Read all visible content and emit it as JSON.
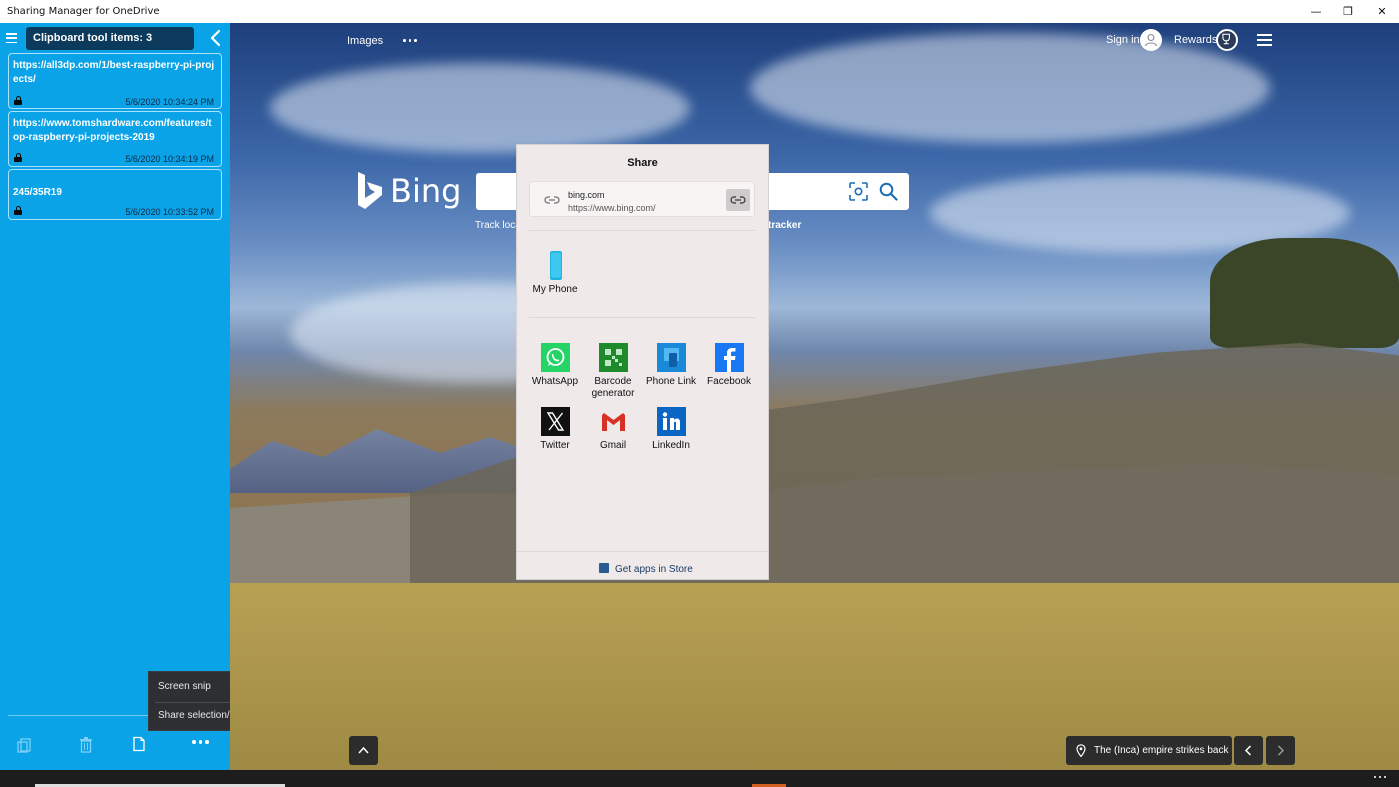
{
  "window": {
    "title": "Sharing Manager for OneDrive",
    "controls": {
      "minimize": "—",
      "restore": "❐",
      "close": "✕"
    }
  },
  "sidebar": {
    "count_label": "Clipboard tool items: 3",
    "items": [
      {
        "text": "https://all3dp.com/1/best-raspberry-pi-projects/",
        "timestamp": "5/6/2020 10:34:24 PM"
      },
      {
        "text": "https://www.tomshardware.com/features/top-raspberry-pi-projects-2019",
        "timestamp": "5/6/2020 10:34:19 PM"
      },
      {
        "text": "245/35R19",
        "timestamp": "5/6/2020 10:33:52 PM"
      }
    ],
    "bottom_icons": [
      "copy-icon",
      "delete-icon",
      "document-icon",
      "more-icon"
    ]
  },
  "context_menu": {
    "items": [
      "Screen snip",
      "Share selection/link"
    ]
  },
  "bing": {
    "nav_images": "Images",
    "sign_in": "Sign in",
    "rewards": "Rewards",
    "logo_text": "Bing",
    "trending_left": "Track loca",
    "trending_right": "tracker"
  },
  "share": {
    "title": "Share",
    "link_host": "bing.com",
    "link_url": "https://www.bing.com/",
    "device_app": "My Phone",
    "apps": [
      {
        "label": "WhatsApp",
        "icon": "whatsapp-icon",
        "color": "#25d366"
      },
      {
        "label": "Barcode generator",
        "icon": "barcode-icon",
        "color": "#1e8a2c"
      },
      {
        "label": "Phone Link",
        "icon": "phone-link-icon",
        "color": "#1a8ad8"
      },
      {
        "label": "Facebook",
        "icon": "facebook-icon",
        "color": "#1877f2"
      },
      {
        "label": "Twitter",
        "icon": "x-icon",
        "color": "#111111"
      },
      {
        "label": "Gmail",
        "icon": "gmail-icon",
        "color": "#d93025"
      },
      {
        "label": "LinkedIn",
        "icon": "linkedin-icon",
        "color": "#0a66c2"
      }
    ],
    "store_label": "Get apps in Store"
  },
  "image_caption": "The (Inca) empire strikes back"
}
